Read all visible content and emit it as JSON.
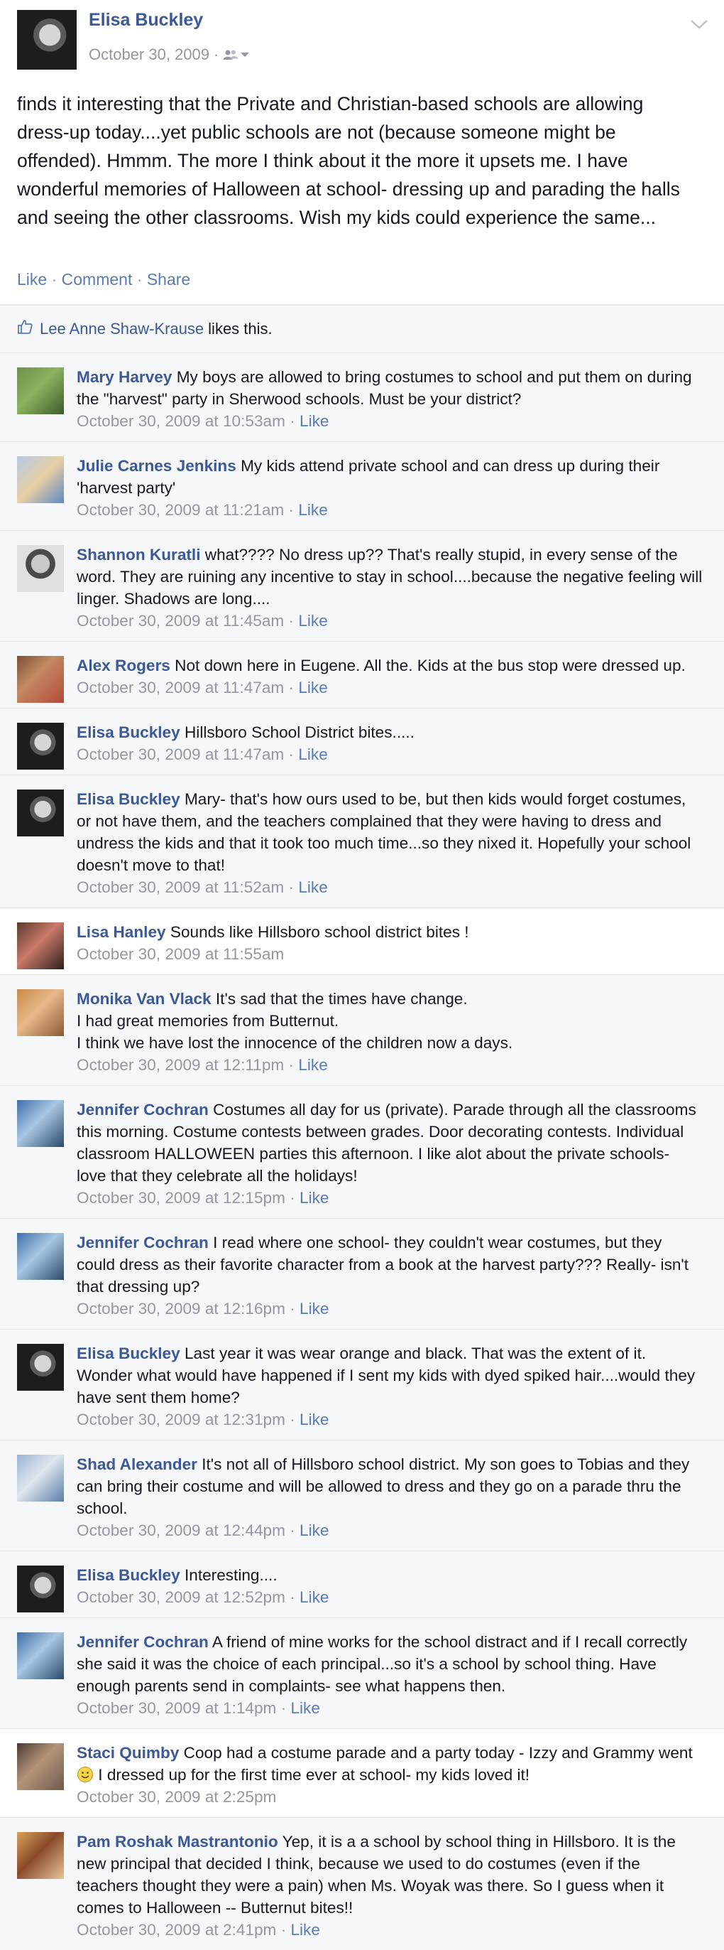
{
  "post": {
    "author": "Elisa Buckley",
    "date": "October 30, 2009",
    "separator": "·",
    "body": "finds it interesting that the Private and Christian-based schools are allowing dress-up today....yet public schools are not (because someone might be offended). Hmmm. The more I think about it the more it upsets me. I have wonderful memories of Halloween at school- dressing up and parading the halls and seeing the other classrooms. Wish my kids could experience the same...",
    "actions": [
      "Like",
      "Comment",
      "Share"
    ],
    "icons": [
      "friends-audience-icon",
      "chevron-down-icon",
      "thumbs-up-icon",
      "smiley-icon"
    ]
  },
  "likes": {
    "name": "Lee Anne Shaw-Krause",
    "suffix": "likes this."
  },
  "colors": {
    "link": "#3b5998",
    "meta": "#9197a3",
    "comment_bg": "#f6f7f8"
  },
  "comments": [
    {
      "name": "Mary Harvey",
      "text": "My boys are allowed to bring costumes to school and put them on during the \"harvest\" party in Sherwood schools. Must be your district?",
      "time": "October 30, 2009 at 10:53am",
      "like": "Like"
    },
    {
      "name": "Julie Carnes Jenkins",
      "text": "My kids attend private school and can dress up during their 'harvest party'",
      "time": "October 30, 2009 at 11:21am",
      "like": "Like"
    },
    {
      "name": "Shannon Kuratli",
      "text": "what???? No dress up?? That's really stupid, in every sense of the word. They are ruining any incentive to stay in school....because the negative feeling will linger. Shadows are long....",
      "time": "October 30, 2009 at 11:45am",
      "like": "Like"
    },
    {
      "name": "Alex Rogers",
      "text": "Not down here in Eugene. All the. Kids at the bus stop were dressed up.",
      "time": "October 30, 2009 at 11:47am",
      "like": "Like"
    },
    {
      "name": "Elisa Buckley",
      "text": "Hillsboro School District bites.....",
      "time": "October 30, 2009 at 11:47am",
      "like": "Like"
    },
    {
      "name": "Elisa Buckley",
      "text": "Mary- that's how ours used to be, but then kids would forget costumes, or not have them, and the teachers complained that they were having to dress and undress the kids and that it took too much time...so they nixed it. Hopefully your school doesn't move to that!",
      "time": "October 30, 2009 at 11:52am",
      "like": "Like"
    },
    {
      "name": "Lisa Hanley",
      "text": "Sounds like Hillsboro school district bites !",
      "time": "October 30, 2009 at 11:55am",
      "like": ""
    },
    {
      "name": "Monika Van Vlack",
      "text": "It's sad that the times have change.\nI had great memories from Butternut.\nI think we have lost the innocence of the children now a days.",
      "time": "October 30, 2009 at 12:11pm",
      "like": "Like"
    },
    {
      "name": "Jennifer Cochran",
      "text": "Costumes all day for us (private). Parade through all the classrooms this morning. Costume contests between grades. Door decorating contests. Individual classroom HALLOWEEN parties this afternoon. I like alot about the private schools- love that they celebrate all the holidays!",
      "time": "October 30, 2009 at 12:15pm",
      "like": "Like"
    },
    {
      "name": "Jennifer Cochran",
      "text": "I read where one school- they couldn't wear costumes, but they could dress as their favorite character from a book at the harvest party??? Really- isn't that dressing up?",
      "time": "October 30, 2009 at 12:16pm",
      "like": "Like"
    },
    {
      "name": "Elisa Buckley",
      "text": "Last year it was wear orange and black. That was the extent of it. Wonder what would have happened if I sent my kids with dyed spiked hair....would they have sent them home?",
      "time": "October 30, 2009 at 12:31pm",
      "like": "Like"
    },
    {
      "name": "Shad Alexander",
      "text": "It's not all of Hillsboro school district. My son goes to Tobias and they can bring their costume and will be allowed to dress and they go on a parade thru the school.",
      "time": "October 30, 2009 at 12:44pm",
      "like": "Like"
    },
    {
      "name": "Elisa Buckley",
      "text": "Interesting....",
      "time": "October 30, 2009 at 12:52pm",
      "like": "Like"
    },
    {
      "name": "Jennifer Cochran",
      "text": "A friend of mine works for the school distract and if I recall correctly she said it was the choice of each principal...so it's a school by school thing. Have enough parents send in complaints- see what happens then.",
      "time": "October 30, 2009 at 1:14pm",
      "like": "Like"
    },
    {
      "name": "Staci Quimby",
      "text_before": "Coop had a costume parade and a party today - Izzy and Grammy went",
      "text_after": "I dressed up for the first time ever at school- my kids loved it!",
      "time": "October 30, 2009 at 2:25pm",
      "like": ""
    },
    {
      "name": "Pam Roshak Mastrantonio",
      "text": "Yep, it is a a school by school thing in Hillsboro. It is the new principal that decided I think, because we used to do costumes (even if the teachers thought they were a pain) when Ms. Woyak was there. So I guess when it comes to Halloween -- Butternut bites!!",
      "time": "October 30, 2009 at 2:41pm",
      "like": "Like"
    }
  ]
}
